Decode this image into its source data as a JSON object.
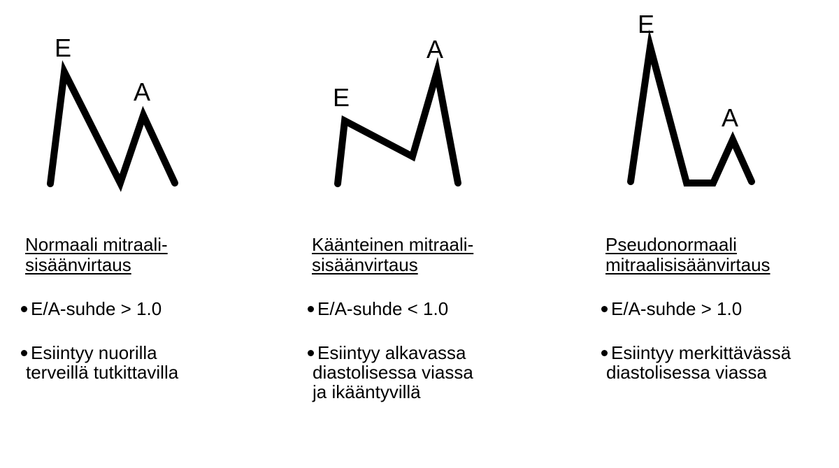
{
  "panels": [
    {
      "title_lines": [
        "Normaali mitraali-",
        "sisäänvirtaus"
      ],
      "ratio": "E/A-suhde > 1.0",
      "occurrence_lines": [
        "Esiintyy nuorilla",
        "terveillä tutkittavilla"
      ],
      "peak_e_label": "E",
      "peak_a_label": "A"
    },
    {
      "title_lines": [
        "Käänteinen mitraali-",
        "sisäänvirtaus"
      ],
      "ratio": "E/A-suhde < 1.0",
      "occurrence_lines": [
        "Esiintyy alkavassa",
        "diastolisessa viassa",
        "ja ikääntyvillä"
      ],
      "peak_e_label": "E",
      "peak_a_label": "A"
    },
    {
      "title_lines": [
        "Pseudonormaali",
        "mitraalisisäänvirtaus"
      ],
      "ratio": "E/A-suhde > 1.0",
      "occurrence_lines": [
        "Esiintyy merkittävässä",
        "diastolisessa viassa"
      ],
      "peak_e_label": "E",
      "peak_a_label": "A"
    }
  ],
  "colors": {
    "stroke": "#000000",
    "background": "#ffffff",
    "text": "#000000"
  }
}
